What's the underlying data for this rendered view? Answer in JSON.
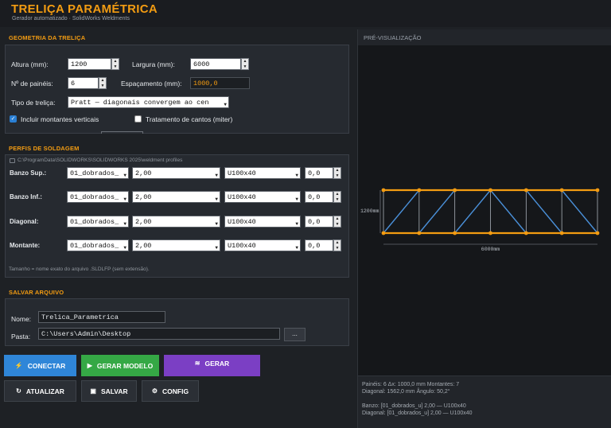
{
  "app": {
    "title": "TRELIÇA PARAMÉTRICA",
    "subtitle": "Gerador automatizado  ·  SolidWorks Weldments"
  },
  "geometry": {
    "section_title": "GEOMETRIA DA TRELIÇA",
    "height_label": "Altura (mm):",
    "height_value": "1200",
    "width_label": "Largura (mm):",
    "width_value": "6000",
    "panels_label": "Nº de painéis:",
    "panels_value": "6",
    "spacing_label": "Espaçamento (mm):",
    "spacing_value": "1000,0",
    "type_label": "Tipo de treliça:",
    "type_value": "Pratt  — diagonais convergem ao cen",
    "verticals_label": "Incluir montantes verticais",
    "verticals_checked": true,
    "miter_label": "Tratamento de cantos (miter)",
    "miter_checked": false
  },
  "profiles": {
    "section_title": "PERFIS DE SOLDAGEM",
    "path": "C:\\ProgramData\\SOLIDWORKS\\SOLIDWORKS 2025\\weldment profiles",
    "rows": [
      {
        "label": "Banzo Sup.:",
        "library": "01_dobrados_",
        "thickness": "2,00",
        "profile": "U100x40",
        "angle": "0,0"
      },
      {
        "label": "Banzo Inf.:",
        "library": "01_dobrados_",
        "thickness": "2,00",
        "profile": "U100x40",
        "angle": "0,0"
      },
      {
        "label": "Diagonal:",
        "library": "01_dobrados_",
        "thickness": "2,00",
        "profile": "U100x40",
        "angle": "0,0"
      },
      {
        "label": "Montante:",
        "library": "01_dobrados_",
        "thickness": "2,00",
        "profile": "U100x40",
        "angle": "0,0"
      }
    ],
    "hint": "Tamanho = nome exato do arquivo .SLDLFP (sem extensão)."
  },
  "save": {
    "section_title": "SALVAR ARQUIVO",
    "name_label": "Nome:",
    "name_value": "Trelica_Parametrica",
    "folder_label": "Pasta:",
    "folder_value": "C:\\Users\\Admin\\Desktop",
    "browse_label": "..."
  },
  "buttons": {
    "connect": "CONECTAR",
    "generate_model": "GERAR MODELO",
    "generate": "GERAR",
    "refresh": "ATUALIZAR",
    "save": "SALVAR",
    "config": "CONFIG"
  },
  "preview": {
    "section_title": "PRÉ-VISUALIZAÇÃO",
    "height_dim": "1200mm",
    "width_dim": "6000mm",
    "stats_line1": "Painéis: 6   Δx: 1000,0 mm   Montantes: 7",
    "stats_line2": "Diagonal: 1562,0 mm   Ângulo: 50,2°",
    "stats_line3": "Banzo: [01_dobrados_u] 2,00 — U100x40",
    "stats_line4": "Diagonal: [01_dobrados_u] 2,00 — U100x40"
  },
  "colors": {
    "accent": "#f39c12",
    "chord": "#f39c12",
    "diagonal": "#4a90d9",
    "vertical": "#a9b0b8",
    "connect": "#2f86d8",
    "generate_model": "#35a845",
    "generate": "#7b3fc4"
  }
}
